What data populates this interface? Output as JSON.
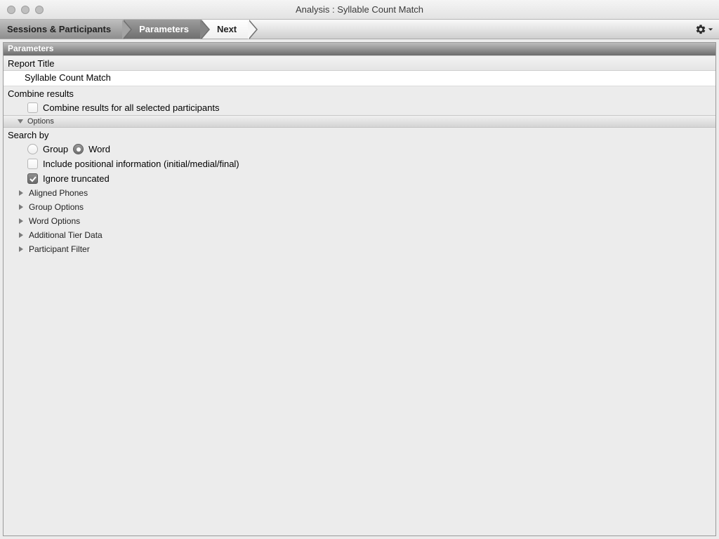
{
  "window": {
    "title": "Analysis : Syllable Count Match"
  },
  "steps": {
    "sessions": "Sessions & Participants",
    "parameters": "Parameters",
    "next": "Next"
  },
  "panel": {
    "title": "Parameters"
  },
  "report_title": {
    "label": "Report Title",
    "value": "Syllable Count Match"
  },
  "combine": {
    "label": "Combine results",
    "checkbox_label": "Combine results for all selected participants",
    "checked": false
  },
  "options_bar": {
    "label": "Options"
  },
  "search_by": {
    "label": "Search by",
    "group": {
      "label": "Group",
      "selected": false
    },
    "word": {
      "label": "Word",
      "selected": true
    },
    "positional": {
      "label": "Include positional information (initial/medial/final)",
      "checked": false
    },
    "ignore_truncated": {
      "label": "Ignore truncated",
      "checked": true
    }
  },
  "tree": {
    "items": [
      {
        "label": "Aligned Phones"
      },
      {
        "label": "Group Options"
      },
      {
        "label": "Word Options"
      },
      {
        "label": "Additional Tier Data"
      },
      {
        "label": "Participant Filter"
      }
    ]
  }
}
